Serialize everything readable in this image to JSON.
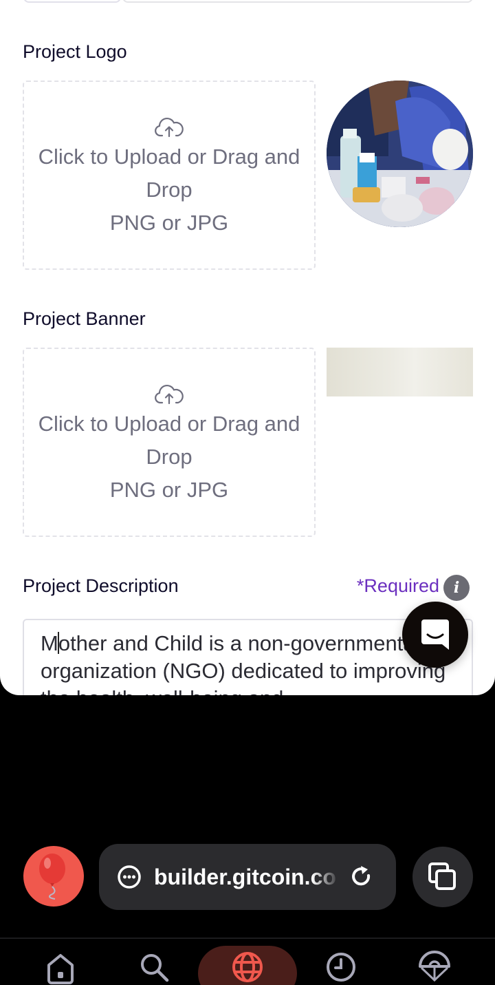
{
  "form": {
    "logo": {
      "label": "Project Logo",
      "upload_text": "Click to Upload or Drag and Drop",
      "hint": "PNG or JPG"
    },
    "banner": {
      "label": "Project Banner",
      "upload_text": "Click to Upload or Drag and Drop",
      "hint": "PNG or JPG"
    },
    "description": {
      "label": "Project Description",
      "required": "*Required",
      "value_start": "M",
      "value_rest": "other and Child is a non-governmental organization (NGO) dedicated to improving the health, well-being and"
    }
  },
  "browser": {
    "url": "builder.gitcoin.co",
    "nav": [
      "home",
      "search",
      "browser",
      "history",
      "vpn"
    ],
    "accent": "#f0584d"
  },
  "icons": {
    "upload": "cloud-upload-icon",
    "info": "info-icon",
    "chat": "chat-icon",
    "balloon": "balloon-icon",
    "reload": "reload-icon",
    "tabs": "tabs-icon"
  },
  "colors": {
    "required": "#6b2fbf",
    "label": "#0f0c2a",
    "muted": "#6e6e7e"
  }
}
